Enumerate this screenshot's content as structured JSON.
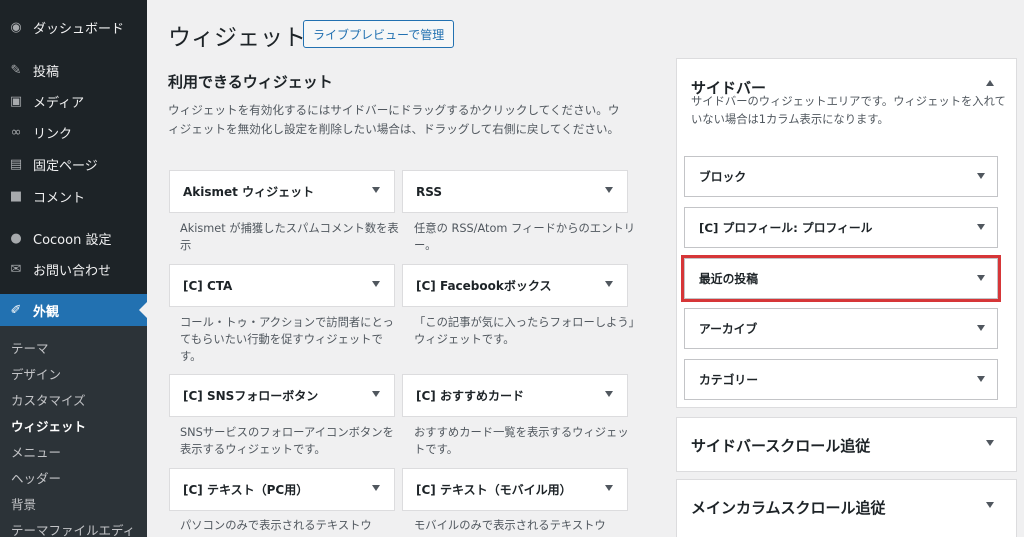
{
  "menu": {
    "dashboard": "ダッシュボード",
    "posts": "投稿",
    "media": "メディア",
    "links": "リンク",
    "pages": "固定ページ",
    "comments": "コメント",
    "cocoon": "Cocoon 設定",
    "contact": "お問い合わせ",
    "appearance": "外観"
  },
  "submenu": {
    "themes": "テーマ",
    "design": "デザイン",
    "customize": "カスタマイズ",
    "widgets": "ウィジェット",
    "menus": "メニュー",
    "header": "ヘッダー",
    "background": "背景",
    "theme_editor": "テーマファイルエディ"
  },
  "header": {
    "title": "ウィジェット",
    "live_preview": "ライブプレビューで管理"
  },
  "available": {
    "title": "利用できるウィジェット",
    "desc": "ウィジェットを有効化するにはサイドバーにドラッグするかクリックしてください。ウィジェットを無効化し設定を削除したい場合は、ドラッグして右側に戻してください。",
    "widgets": [
      {
        "name": "Akismet ウィジェット",
        "desc": "Akismet が捕獲したスパムコメント数を表示"
      },
      {
        "name": "RSS",
        "desc": "任意の RSS/Atom フィードからのエントリー。"
      },
      {
        "name": "[C] CTA",
        "desc": "コール・トゥ・アクションで訪問者にとってもらいたい行動を促すウィジェットです。"
      },
      {
        "name": "[C] Facebookボックス",
        "desc": "「この記事が気に入ったらフォローしよう」ウィジェットです。"
      },
      {
        "name": "[C] SNSフォローボタン",
        "desc": "SNSサービスのフォローアイコンボタンを表示するウィジェットです。"
      },
      {
        "name": "[C] おすすめカード",
        "desc": "おすすめカード一覧を表示するウィジェットです。"
      },
      {
        "name": "[C] テキスト（PC用）",
        "desc": "パソコンのみで表示されるテキストウ"
      },
      {
        "name": "[C] テキスト（モバイル用）",
        "desc": "モバイルのみで表示されるテキストウ"
      }
    ]
  },
  "sidebar_panel": {
    "title": "サイドバー",
    "desc": "サイドバーのウィジェットエリアです。ウィジェットを入れていない場合は1カラム表示になります。",
    "widgets": [
      {
        "name": "ブロック"
      },
      {
        "name": "[C] プロフィール: プロフィール"
      },
      {
        "name": "最近の投稿"
      },
      {
        "name": "アーカイブ"
      },
      {
        "name": "カテゴリー"
      }
    ]
  },
  "scroll_panel": {
    "title": "サイドバースクロール追従"
  },
  "main_scroll_panel": {
    "title": "メインカラムスクロール追従"
  },
  "colors": {
    "accent": "#2271b1",
    "highlight": "#d63638",
    "sidebar_bg": "#1d2327"
  }
}
